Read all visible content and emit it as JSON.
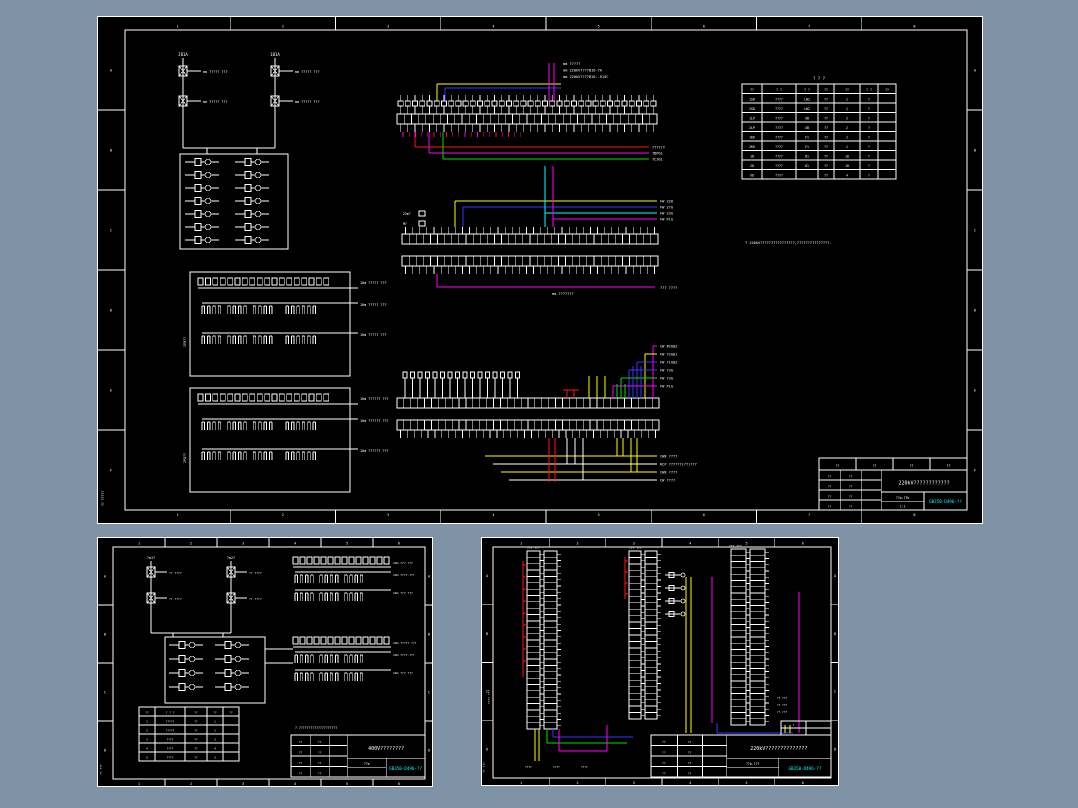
{
  "app": {
    "background": "#7f93a7"
  },
  "colors": {
    "sheet_bg": "#000000",
    "line": "#ffffff",
    "yellow": "#ffff00",
    "blue": "#3838ff",
    "magenta": "#ff00ff",
    "green": "#00e100",
    "red": "#ff1414",
    "cyan": "#00ffff",
    "dwg_no": "#00ffff"
  },
  "zones": {
    "cols8": [
      "1",
      "2",
      "3",
      "4",
      "5",
      "6",
      "7",
      "8"
    ],
    "cols6": [
      "1",
      "2",
      "3",
      "4",
      "5",
      "6"
    ],
    "rowsAF": [
      "A",
      "B",
      "C",
      "D",
      "E",
      "F"
    ],
    "rowsAD": [
      "A",
      "B",
      "C",
      "D"
    ]
  },
  "sheet_main": {
    "corner_text": "?? ?????",
    "circuit_headers": [
      "JB1A",
      "1B1A"
    ],
    "circuit_labels": [
      "mm ????? ???",
      "mm ????? ???",
      "mm ????? ???",
      "mm ????? ???"
    ],
    "strip1": {
      "wire_labels": [
        "mm ?????",
        "mm 220kV????B16-?A",
        "mm 220kV????B16--915C"
      ],
      "out_labels": [
        "????(T",
        "?BPG1",
        "?C3G1"
      ]
    },
    "strip2": {
      "in_labels": [
        "FW 220",
        "FW 27G",
        "FW 23G",
        "FW P1G"
      ],
      "left_labels": [
        "25m?",
        "M?"
      ],
      "below_label": "mm ???????",
      "below_wire_label": "??? ????"
    },
    "strip3": {
      "out_labels": [
        "CW #2G02",
        "FW ?2G01",
        "FW ?1G02",
        "FW ?3G",
        "FW ?3G",
        "FW P1G"
      ],
      "below_labels": [
        "CW8 ????",
        "RCP ??????(??)???",
        "CW8 ????",
        "CW ????"
      ]
    },
    "left_block1": {
      "side": "1PD??",
      "labels": [
        "10m ????? ???",
        "10m ????? ???",
        "10m ????? ???"
      ]
    },
    "left_block2": {
      "side": "2PD??",
      "labels": [
        "10m ?????? ???",
        "10m ?????? ???",
        "10m ?????? ???"
      ]
    },
    "note": "? 220kV????????????????,???????????????.",
    "table": {
      "title": "? ? ?",
      "rows": [
        [
          "??",
          "? ?",
          "? ?",
          "??",
          "??",
          "? ?",
          "??"
        ],
        [
          "1SD",
          "????",
          "LW2",
          "??",
          "1",
          "?",
          ""
        ],
        [
          "2SD",
          "????",
          "LW2",
          "??",
          "1",
          "?",
          ""
        ],
        [
          "1LP",
          "????",
          "XB",
          "??",
          "2",
          "?",
          ""
        ],
        [
          "2LP",
          "????",
          "XB",
          "??",
          "2",
          "?",
          ""
        ],
        [
          "1KK",
          "????",
          "F1",
          "??",
          "1",
          "?",
          ""
        ],
        [
          "2KK",
          "????",
          "F1",
          "??",
          "1",
          "?",
          ""
        ],
        [
          "1D",
          "????",
          "D1",
          "??",
          "10",
          "?",
          ""
        ],
        [
          "2D",
          "????",
          "D1",
          "??",
          "10",
          "?",
          ""
        ],
        [
          "XD",
          "????",
          "",
          "??",
          "4",
          "?",
          ""
        ]
      ]
    },
    "revision_row": [
      "??",
      "??",
      "??",
      "??"
    ],
    "title_block": {
      "left_rows": [
        [
          "??",
          "??",
          ""
        ],
        [
          "??",
          "??",
          ""
        ],
        [
          "??",
          "??",
          ""
        ],
        [
          "??",
          "??",
          ""
        ]
      ],
      "title": "220kV????????????",
      "model": "??m-??b",
      "scale": "1:1",
      "drawing_no": "GB350-D496-??"
    }
  },
  "sheet_bl": {
    "corner_text": "?? ???",
    "circuit_headers": [
      "?m1?",
      "?m2?"
    ],
    "circuit_labels": [
      "?? ????",
      "?? ????"
    ],
    "strip_labels": [
      "10m ???.???",
      "10m ????.???",
      "10m ???.???",
      "10m ????? ???",
      "10m ????.???",
      "10m ???.???"
    ],
    "note": "? ????????????????????",
    "table_rows": [
      [
        "??",
        "? ? ?",
        "??",
        "??",
        "??"
      ],
      [
        "1",
        "?????",
        "??",
        "1",
        ""
      ],
      [
        "2",
        "?????",
        "??",
        "1",
        ""
      ],
      [
        "3",
        "????",
        "??",
        "2",
        ""
      ],
      [
        "4",
        "????",
        "??",
        "4",
        ""
      ],
      [
        "5",
        "????",
        "??",
        "2",
        ""
      ]
    ],
    "title_block": {
      "left_rows": [
        [
          "??",
          "??",
          ""
        ],
        [
          "??",
          "??",
          ""
        ],
        [
          "??",
          "??",
          ""
        ],
        [
          "??",
          "??",
          ""
        ]
      ],
      "title": "400V????????",
      "model": "??b",
      "scale": "",
      "drawing_no": "GB350-D496-??"
    }
  },
  "sheet_br": {
    "corner_text": "?? ???",
    "side_text": "???? ???",
    "strip_headers": [
      "??? ???",
      "??? ???",
      "??? ???"
    ],
    "bottom_labels": [
      "????",
      "????",
      "????"
    ],
    "right_labels": [
      "?? ???",
      "?? ???",
      "?? ???"
    ],
    "stamp_cells": [
      [
        "?",
        ""
      ],
      [
        "",
        ""
      ]
    ],
    "title_block": {
      "left_rows": [
        [
          "??",
          "??",
          ""
        ],
        [
          "??",
          "??",
          ""
        ],
        [
          "??",
          "??",
          ""
        ],
        [
          "??",
          "??",
          ""
        ]
      ],
      "title": "220kV??????????????",
      "model": "??b-???",
      "scale": "",
      "drawing_no": "GB350-D496-??"
    }
  }
}
